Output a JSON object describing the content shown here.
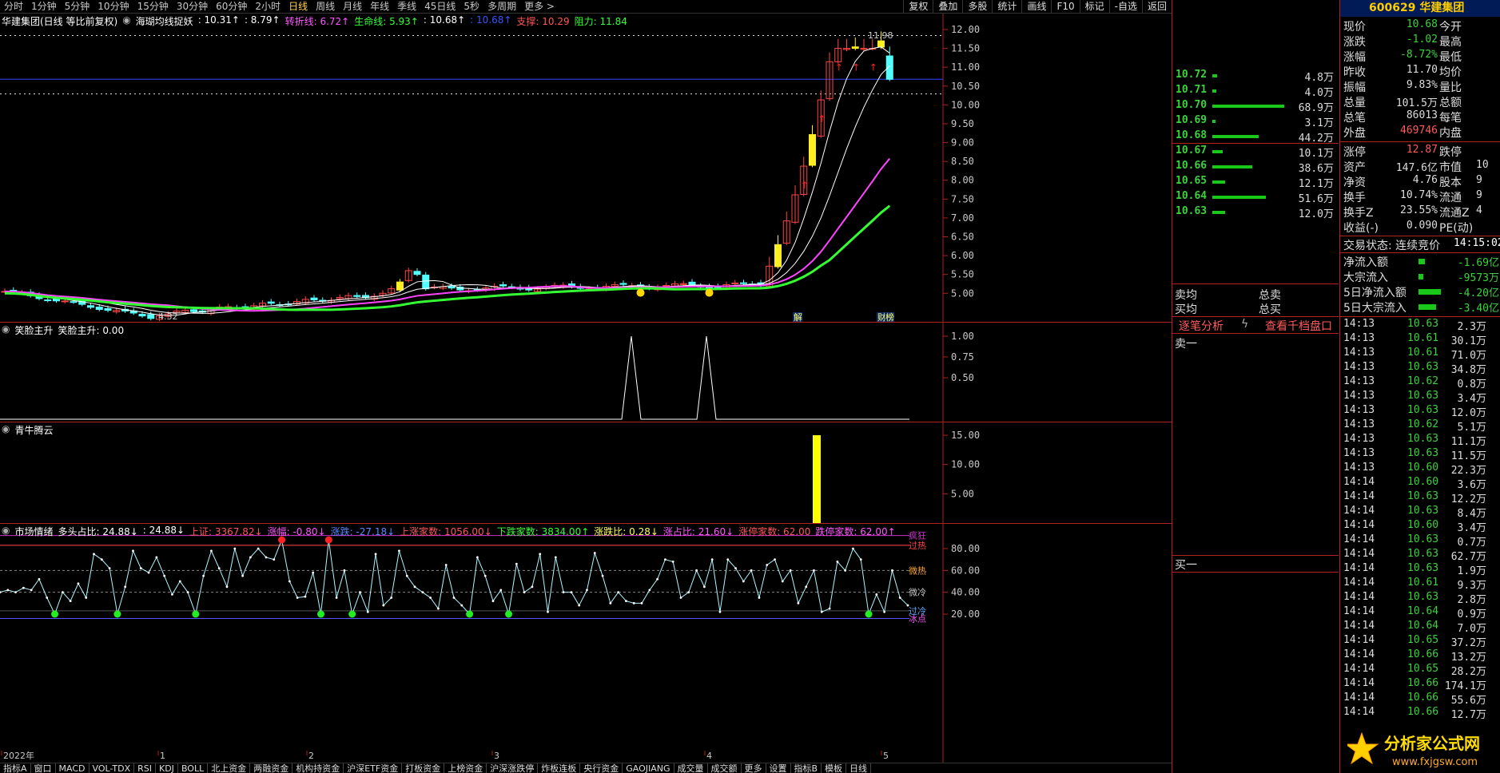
{
  "toolbar": {
    "periods": [
      {
        "label": "分时"
      },
      {
        "label": "1分钟"
      },
      {
        "label": "5分钟"
      },
      {
        "label": "10分钟"
      },
      {
        "label": "15分钟"
      },
      {
        "label": "30分钟"
      },
      {
        "label": "60分钟"
      },
      {
        "label": "2小时"
      },
      {
        "label": "日线",
        "active": true
      },
      {
        "label": "周线"
      },
      {
        "label": "月线"
      },
      {
        "label": "年线"
      },
      {
        "label": "季线"
      },
      {
        "label": "45日线"
      },
      {
        "label": "5秒"
      },
      {
        "label": "多周期"
      },
      {
        "label": "更多 >"
      }
    ],
    "tools": [
      {
        "label": "复权"
      },
      {
        "label": "叠加"
      },
      {
        "label": "多股"
      },
      {
        "label": "统计"
      },
      {
        "label": "画线"
      },
      {
        "label": "F10"
      },
      {
        "label": "标记"
      },
      {
        "label": "-自选"
      },
      {
        "label": "返回"
      }
    ]
  },
  "main_panel": {
    "title": "华建集团(日线 等比前复权)",
    "indicator_name": "海瑚均线捉妖",
    "values": [
      {
        "text": ": 10.31↑",
        "color": "#ffffff"
      },
      {
        "text": ": 8.79↑",
        "color": "#ffffff"
      },
      {
        "text": "转折线: 6.72↑",
        "color": "#ff55ff"
      },
      {
        "text": "生命线: 5.93↑",
        "color": "#33ff33"
      },
      {
        "text": ": 10.68↑",
        "color": "#ffffff"
      },
      {
        "text": ": 10.68↑",
        "color": "#3355ff"
      },
      {
        "text": "支撑: 10.29",
        "color": "#ff5555"
      },
      {
        "text": "阻力: 11.84",
        "color": "#33ff33"
      }
    ],
    "high_label": "11.98",
    "low_label": "4.32",
    "price_ticks": [
      "12.00",
      "11.50",
      "11.00",
      "10.50",
      "10.00",
      "9.50",
      "9.00",
      "8.50",
      "8.00",
      "7.50",
      "7.00",
      "6.50",
      "6.00",
      "5.50",
      "5.00"
    ],
    "event_labels": [
      {
        "text": "解"
      },
      {
        "text": "财"
      },
      {
        "text": "榜"
      }
    ]
  },
  "smile_panel": {
    "title": "笑脸主升",
    "value": "笑脸主升: 0.00",
    "ticks": [
      "1.00",
      "0.75",
      "0.50"
    ]
  },
  "qiniu_panel": {
    "title": "青牛腾云",
    "ticks": [
      "15.00",
      "10.00",
      "5.00"
    ],
    "bar_value": 15
  },
  "sentiment_panel": {
    "title": "市场情绪",
    "values": [
      {
        "text": "多头占比: 24.88↓",
        "color": "#ffffff"
      },
      {
        "text": ": 24.88↓",
        "color": "#ffffff"
      },
      {
        "text": "上证: 3367.82↓",
        "color": "#ff5555"
      },
      {
        "text": "涨幅: -0.80↓",
        "color": "#ff55ff"
      },
      {
        "text": "涨跌: -27.18↓",
        "color": "#5588ff"
      },
      {
        "text": "上涨家数: 1056.00↓",
        "color": "#ff5555"
      },
      {
        "text": "下跌家数: 3834.00↑",
        "color": "#33ff33"
      },
      {
        "text": "涨跌比: 0.28↓",
        "color": "#ffff55"
      },
      {
        "text": "涨占比: 21.60↓",
        "color": "#ff55ff"
      },
      {
        "text": "涨停家数: 62.00",
        "color": "#ff5555"
      },
      {
        "text": "跌停家数: 62.00↑",
        "color": "#ff55ff"
      }
    ],
    "ticks": [
      "80.00",
      "60.00",
      "40.00",
      "20.00"
    ],
    "zones": [
      {
        "text": "疯狂"
      },
      {
        "text": "过热"
      },
      {
        "text": "微热"
      },
      {
        "text": "微冷"
      },
      {
        "text": "过冷"
      },
      {
        "text": "冰点"
      }
    ],
    "series": [
      40,
      42,
      40,
      44,
      42,
      52,
      35,
      20,
      40,
      32,
      48,
      35,
      75,
      70,
      62,
      20,
      45,
      78,
      62,
      58,
      72,
      55,
      38,
      50,
      40,
      20,
      55,
      78,
      62,
      45,
      80,
      55,
      72,
      80,
      72,
      70,
      88,
      50,
      35,
      36,
      58,
      20,
      88,
      35,
      60,
      20,
      40,
      22,
      75,
      28,
      35,
      78,
      55,
      45,
      40,
      35,
      25,
      65,
      35,
      28,
      20,
      72,
      55,
      32,
      42,
      20,
      66,
      40,
      45,
      75,
      22,
      72,
      40,
      40,
      28,
      42,
      76,
      55,
      30,
      40,
      32,
      30,
      30,
      42,
      52,
      70,
      68,
      35,
      40,
      60,
      45,
      70,
      22,
      70,
      62,
      50,
      60,
      35,
      65,
      70,
      50,
      60,
      30,
      45,
      60,
      22,
      25,
      68,
      60,
      80,
      70,
      20,
      38,
      22,
      60,
      35,
      28
    ]
  },
  "x_labels": [
    {
      "text": "2022年"
    },
    {
      "text": "1"
    },
    {
      "text": "2"
    },
    {
      "text": "3"
    },
    {
      "text": "4"
    },
    {
      "text": "5"
    }
  ],
  "bottom_tabs": [
    {
      "label": "指标A"
    },
    {
      "label": "窗口"
    },
    {
      "label": "MACD"
    },
    {
      "label": "VOL-TDX"
    },
    {
      "label": "RSI"
    },
    {
      "label": "KDJ"
    },
    {
      "label": "BOLL"
    },
    {
      "label": "北上资金"
    },
    {
      "label": "两融资金"
    },
    {
      "label": "机构持资金"
    },
    {
      "label": "沪深ETF资金"
    },
    {
      "label": "打板资金"
    },
    {
      "label": "上榜资金"
    },
    {
      "label": "沪深涨跌停"
    },
    {
      "label": "炸板连板"
    },
    {
      "label": "央行资金"
    },
    {
      "label": "GAOJIANG"
    },
    {
      "label": "成交量"
    },
    {
      "label": "成交额"
    },
    {
      "label": "更多"
    },
    {
      "label": "设置"
    },
    {
      "label": "指标B"
    },
    {
      "label": "模板"
    },
    {
      "label": "日线"
    }
  ],
  "order_book": {
    "asks": [
      {
        "price": "10.72",
        "vol": "4.8万",
        "bar": 4.8
      },
      {
        "price": "10.71",
        "vol": "4.0万",
        "bar": 4.0
      },
      {
        "price": "10.70",
        "vol": "68.9万",
        "bar": 68.9
      },
      {
        "price": "10.69",
        "vol": "3.1万",
        "bar": 3.1
      },
      {
        "price": "10.68",
        "vol": "44.2万",
        "bar": 44.2
      }
    ],
    "bids": [
      {
        "price": "10.67",
        "vol": "10.1万",
        "bar": 10.1
      },
      {
        "price": "10.66",
        "vol": "38.6万",
        "bar": 38.6
      },
      {
        "price": "10.65",
        "vol": "12.1万",
        "bar": 12.1
      },
      {
        "price": "10.64",
        "vol": "51.6万",
        "bar": 51.6
      },
      {
        "price": "10.63",
        "vol": "12.0万",
        "bar": 12.0
      }
    ],
    "sell_avg": "卖均",
    "buy_avg": "买均",
    "total_sell": "总卖",
    "total_buy": "总买",
    "tick_analysis": "逐笔分析",
    "view_depth": "查看千档盘口",
    "sell1": "卖一",
    "buy1": "买一"
  },
  "quote": {
    "code": "600629",
    "name": "华建集团",
    "rows": [
      {
        "l": "现价",
        "v": "10.68",
        "c": "#3ad33a",
        "l2": "今开"
      },
      {
        "l": "涨跌",
        "v": "-1.02",
        "c": "#3ad33a",
        "l2": "最高"
      },
      {
        "l": "涨幅",
        "v": "-8.72%",
        "c": "#3ad33a",
        "l2": "最低"
      },
      {
        "l": "昨收",
        "v": "11.70",
        "c": "#dddddd",
        "l2": "均价"
      },
      {
        "l": "振幅",
        "v": "9.83%",
        "c": "#dddddd",
        "l2": "量比"
      },
      {
        "l": "总量",
        "v": "101.5万",
        "c": "#dddddd",
        "l2": "总额"
      },
      {
        "l": "总笔",
        "v": "86013",
        "c": "#dddddd",
        "l2": "每笔"
      },
      {
        "l": "外盘",
        "v": "469746",
        "c": "#ff5a5a",
        "l2": "内盘"
      },
      {
        "l": "涨停",
        "v": "12.87",
        "c": "#ff5a5a",
        "l2": "跌停"
      },
      {
        "l": "资产",
        "v": "147.6亿",
        "c": "#dddddd",
        "l2": "市值",
        "v2": "10"
      },
      {
        "l": "净资",
        "v": "4.76",
        "c": "#dddddd",
        "l2": "股本",
        "v2": "9"
      },
      {
        "l": "换手",
        "v": "10.74%",
        "c": "#dddddd",
        "l2": "流通",
        "v2": "9"
      },
      {
        "l": "换手Z",
        "v": "23.55%",
        "c": "#dddddd",
        "l2": "流通Z",
        "v2": "4"
      },
      {
        "l": "收益(-)",
        "v": "0.090",
        "c": "#dddddd",
        "l2": "PE(动)"
      }
    ],
    "trade_status": "交易状态: 连续竞价",
    "trade_time": "14:15:02",
    "flows": [
      {
        "l": "净流入额",
        "v": "-1.69亿",
        "bar": 8
      },
      {
        "l": "大宗流入",
        "v": "-9573万",
        "bar": 6
      },
      {
        "l": "5日净流入额",
        "v": "-4.20亿",
        "bar": 28
      },
      {
        "l": "5日大宗流入",
        "v": "-3.40亿",
        "bar": 22
      }
    ],
    "ticks": [
      {
        "t": "14:13",
        "p": "10.63",
        "v": "2.3万"
      },
      {
        "t": "14:13",
        "p": "10.61",
        "v": "30.1万"
      },
      {
        "t": "14:13",
        "p": "10.61",
        "v": "71.0万"
      },
      {
        "t": "14:13",
        "p": "10.63",
        "v": "34.8万"
      },
      {
        "t": "14:13",
        "p": "10.62",
        "v": "0.8万"
      },
      {
        "t": "14:13",
        "p": "10.63",
        "v": "3.4万"
      },
      {
        "t": "14:13",
        "p": "10.63",
        "v": "12.0万"
      },
      {
        "t": "14:13",
        "p": "10.62",
        "v": "5.1万"
      },
      {
        "t": "14:13",
        "p": "10.63",
        "v": "11.1万"
      },
      {
        "t": "14:13",
        "p": "10.63",
        "v": "11.5万"
      },
      {
        "t": "14:13",
        "p": "10.60",
        "v": "22.3万"
      },
      {
        "t": "14:14",
        "p": "10.60",
        "v": "3.6万"
      },
      {
        "t": "14:14",
        "p": "10.63",
        "v": "12.2万"
      },
      {
        "t": "14:14",
        "p": "10.63",
        "v": "8.4万"
      },
      {
        "t": "14:14",
        "p": "10.60",
        "v": "3.4万"
      },
      {
        "t": "14:14",
        "p": "10.63",
        "v": "0.7万"
      },
      {
        "t": "14:14",
        "p": "10.63",
        "v": "62.7万"
      },
      {
        "t": "14:14",
        "p": "10.63",
        "v": "1.9万"
      },
      {
        "t": "14:14",
        "p": "10.61",
        "v": "9.3万"
      },
      {
        "t": "14:14",
        "p": "10.63",
        "v": "2.8万"
      },
      {
        "t": "14:14",
        "p": "10.64",
        "v": "0.9万"
      },
      {
        "t": "14:14",
        "p": "10.64",
        "v": "7.0万"
      },
      {
        "t": "14:14",
        "p": "10.65",
        "v": "37.2万"
      },
      {
        "t": "14:14",
        "p": "10.66",
        "v": "13.2万"
      },
      {
        "t": "14:14",
        "p": "10.65",
        "v": "28.2万"
      },
      {
        "t": "14:14",
        "p": "10.66",
        "v": "174.1万"
      },
      {
        "t": "14:14",
        "p": "10.66",
        "v": "55.6万"
      },
      {
        "t": "14:14",
        "p": "10.66",
        "v": "12.7万"
      }
    ]
  },
  "watermark": {
    "text": "分析家公式网",
    "url": "www.fxjgsw.com"
  }
}
